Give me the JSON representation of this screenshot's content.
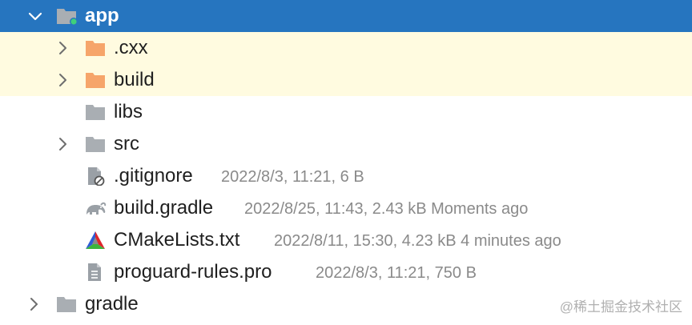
{
  "tree": {
    "root": {
      "name": "app",
      "icon": "module-folder-icon"
    },
    "cxx": {
      "name": ".cxx",
      "icon": "excluded-folder-icon"
    },
    "build": {
      "name": "build",
      "icon": "excluded-folder-icon"
    },
    "libs": {
      "name": "libs",
      "icon": "folder-icon"
    },
    "src": {
      "name": "src",
      "icon": "folder-icon"
    },
    "gitignore": {
      "name": ".gitignore",
      "meta": "2022/8/3, 11:21, 6 B",
      "icon": "ignored-file-icon"
    },
    "build_gradle": {
      "name": "build.gradle",
      "meta": "2022/8/25, 11:43, 2.43 kB Moments ago",
      "icon": "gradle-elephant-icon"
    },
    "cmakelists": {
      "name": "CMakeLists.txt",
      "meta": "2022/8/11, 15:30, 4.23 kB 4 minutes ago",
      "icon": "cmake-icon"
    },
    "proguard": {
      "name": "proguard-rules.pro",
      "meta": "2022/8/3, 11:21, 750 B",
      "icon": "text-file-icon"
    },
    "gradle": {
      "name": "gradle",
      "icon": "folder-icon"
    }
  },
  "colors": {
    "selection": "#2675bf",
    "excluded_row": "#fffbe0",
    "excluded_folder": "#f6a56a",
    "folder": "#a9aeb3",
    "meta_text": "#8a8a8a"
  },
  "watermark": "@稀土掘金技术社区"
}
